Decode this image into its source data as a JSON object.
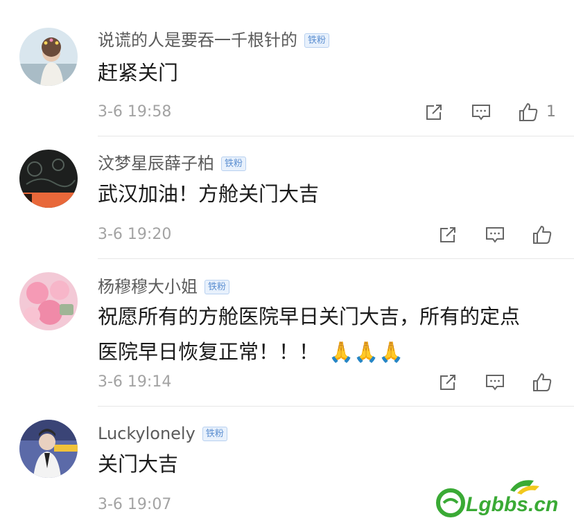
{
  "comments": [
    {
      "name": "说谎的人是要吞一千根针的",
      "badge": "铁粉",
      "text": "赶紧关门",
      "time": "3-6 19:58",
      "likes": "1"
    },
    {
      "name": "汶梦星辰薛子柏",
      "badge": "铁粉",
      "text": "武汉加油！方舱关门大吉",
      "time": "3-6 19:20",
      "likes": ""
    },
    {
      "name": "杨穆穆大小姐",
      "badge": "铁粉",
      "text_line1": "祝愿所有的方舱医院早日关门大吉，所有的定点",
      "text_line2": "医院早日恢复正常！！！",
      "emojis": "🙏🙏🙏",
      "time": "3-6 19:14",
      "likes": ""
    },
    {
      "name": "Luckylonely",
      "badge": "铁粉",
      "text": "关门大吉",
      "time": "3-6 19:07",
      "likes": ""
    }
  ],
  "watermark": "Lgbbs.cn",
  "icons": {
    "share": "share-icon",
    "comment": "comment-icon",
    "like": "thumbs-up-icon"
  },
  "colors": {
    "name": "#5b5b5b",
    "text": "#1a1a1a",
    "time": "#a3a3a3",
    "badge_bg": "#e8f1fc",
    "badge_text": "#5c8fd1",
    "watermark_green": "#3aaa35"
  }
}
